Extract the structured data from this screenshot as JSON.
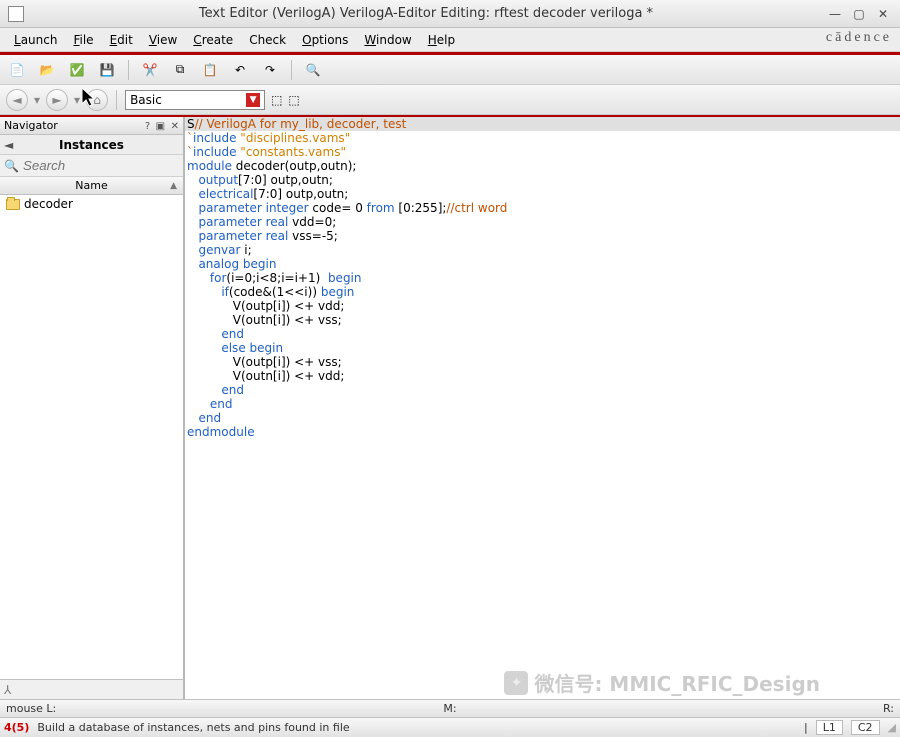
{
  "window": {
    "title": "Text Editor (VerilogA) VerilogA-Editor Editing: rftest decoder veriloga *"
  },
  "menu": [
    {
      "label": "Launch",
      "u": 0
    },
    {
      "label": "File",
      "u": 0
    },
    {
      "label": "Edit",
      "u": 0
    },
    {
      "label": "View",
      "u": 0
    },
    {
      "label": "Create",
      "u": 0
    },
    {
      "label": "Check",
      "u": -1
    },
    {
      "label": "Options",
      "u": 0
    },
    {
      "label": "Window",
      "u": 0
    },
    {
      "label": "Help",
      "u": 0
    }
  ],
  "brand": "cādence",
  "toolbar2": {
    "dropdown": "Basic"
  },
  "navigator": {
    "title": "Navigator",
    "section": "Instances",
    "search_placeholder": "Search",
    "column": "Name",
    "items": [
      {
        "label": "decoder"
      }
    ]
  },
  "code": {
    "first_marker": "S",
    "lines": [
      {
        "seg": [
          {
            "t": "// VerilogA for my_lib, decoder, test",
            "c": "cmt"
          }
        ]
      },
      {
        "seg": [
          {
            "t": "`",
            "c": "tick"
          },
          {
            "t": "include ",
            "c": "kw"
          },
          {
            "t": "\"disciplines.vams\"",
            "c": "str"
          }
        ]
      },
      {
        "seg": [
          {
            "t": "`",
            "c": "tick"
          },
          {
            "t": "include ",
            "c": "kw"
          },
          {
            "t": "\"constants.vams\"",
            "c": "str"
          }
        ]
      },
      {
        "seg": [
          {
            "t": "",
            "c": ""
          }
        ]
      },
      {
        "seg": [
          {
            "t": "module",
            "c": "kw"
          },
          {
            "t": " decoder(outp,outn);",
            "c": ""
          }
        ]
      },
      {
        "seg": [
          {
            "t": "   ",
            "c": ""
          },
          {
            "t": "output",
            "c": "kw"
          },
          {
            "t": "[7:0] outp,outn;",
            "c": ""
          }
        ]
      },
      {
        "seg": [
          {
            "t": "   ",
            "c": ""
          },
          {
            "t": "electrical",
            "c": "kw"
          },
          {
            "t": "[7:0] outp,outn;",
            "c": ""
          }
        ]
      },
      {
        "seg": [
          {
            "t": "   ",
            "c": ""
          },
          {
            "t": "parameter integer",
            "c": "kw"
          },
          {
            "t": " code=",
            "c": ""
          },
          {
            "t": " 0 ",
            "c": "num"
          },
          {
            "t": "from",
            "c": "kw"
          },
          {
            "t": " [0:255];",
            "c": ""
          },
          {
            "t": "//ctrl word",
            "c": "cmt"
          }
        ]
      },
      {
        "seg": [
          {
            "t": "   ",
            "c": ""
          },
          {
            "t": "parameter real",
            "c": "kw"
          },
          {
            "t": " vdd=0;",
            "c": ""
          }
        ]
      },
      {
        "seg": [
          {
            "t": "   ",
            "c": ""
          },
          {
            "t": "parameter real",
            "c": "kw"
          },
          {
            "t": " vss=-5;",
            "c": ""
          }
        ]
      },
      {
        "seg": [
          {
            "t": "   ",
            "c": ""
          },
          {
            "t": "genvar",
            "c": "kw"
          },
          {
            "t": " i;",
            "c": ""
          }
        ]
      },
      {
        "seg": [
          {
            "t": "   ",
            "c": ""
          },
          {
            "t": "analog begin",
            "c": "kw"
          }
        ]
      },
      {
        "seg": [
          {
            "t": "      ",
            "c": ""
          },
          {
            "t": "for",
            "c": "kw"
          },
          {
            "t": "(i=0;i<8;i=i+1)  ",
            "c": ""
          },
          {
            "t": "begin",
            "c": "kw"
          }
        ]
      },
      {
        "seg": [
          {
            "t": "         ",
            "c": ""
          },
          {
            "t": "if",
            "c": "kw"
          },
          {
            "t": "(code&(1<<i)) ",
            "c": ""
          },
          {
            "t": "begin",
            "c": "kw"
          }
        ]
      },
      {
        "seg": [
          {
            "t": "            V(outp[i]) <+ vdd;",
            "c": ""
          }
        ]
      },
      {
        "seg": [
          {
            "t": "            V(outn[i]) <+ vss;",
            "c": ""
          }
        ]
      },
      {
        "seg": [
          {
            "t": "         ",
            "c": ""
          },
          {
            "t": "end",
            "c": "kw"
          }
        ]
      },
      {
        "seg": [
          {
            "t": "         ",
            "c": ""
          },
          {
            "t": "else begin",
            "c": "kw"
          }
        ]
      },
      {
        "seg": [
          {
            "t": "            V(outp[i]) <+ vss;",
            "c": ""
          }
        ]
      },
      {
        "seg": [
          {
            "t": "            V(outn[i]) <+ vdd;",
            "c": ""
          }
        ]
      },
      {
        "seg": [
          {
            "t": "         ",
            "c": ""
          },
          {
            "t": "end",
            "c": "kw"
          }
        ]
      },
      {
        "seg": [
          {
            "t": "      ",
            "c": ""
          },
          {
            "t": "end",
            "c": "kw"
          }
        ]
      },
      {
        "seg": [
          {
            "t": "   ",
            "c": ""
          },
          {
            "t": "end",
            "c": "kw"
          }
        ]
      },
      {
        "seg": [
          {
            "t": "endmodule",
            "c": "kw"
          }
        ]
      }
    ]
  },
  "status": {
    "mouse_left": "mouse L:",
    "mid": "M:",
    "right": "R:"
  },
  "bottom": {
    "count": "4(5)",
    "msg": "Build a database of instances, nets and pins found in file",
    "line": "L1",
    "col": "C2"
  },
  "watermark": "微信号: MMIC_RFIC_Design"
}
